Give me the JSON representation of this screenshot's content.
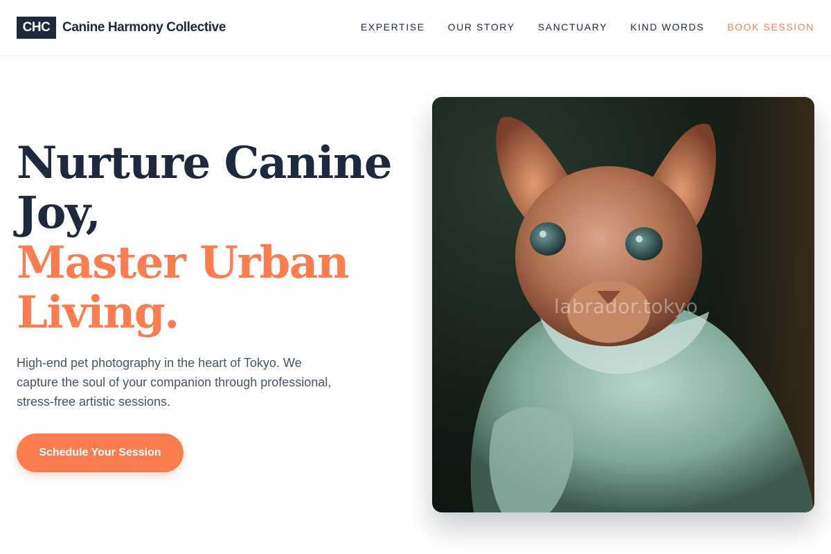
{
  "brand": {
    "logo_text": "CHC",
    "name": "Canine Harmony Collective"
  },
  "nav": {
    "items": [
      {
        "label": "EXPERTISE"
      },
      {
        "label": "OUR STORY"
      },
      {
        "label": "SANCTUARY"
      },
      {
        "label": "KIND WORDS"
      },
      {
        "label": "BOOK SESSION"
      }
    ]
  },
  "hero": {
    "title_line1": "Nurture Canine",
    "title_line2": "Joy,",
    "title_accent_line1": "Master Urban",
    "title_accent_line2": "Living.",
    "description": "High-end pet photography in the heart of Tokyo. We capture the soul of your companion through professional, stress-free artistic sessions.",
    "cta_label": "Schedule Your Session",
    "image_watermark": "labrador.tokyo"
  },
  "colors": {
    "primary_dark": "#1e293b",
    "accent": "#fb7c4e",
    "body_text": "#475569"
  }
}
